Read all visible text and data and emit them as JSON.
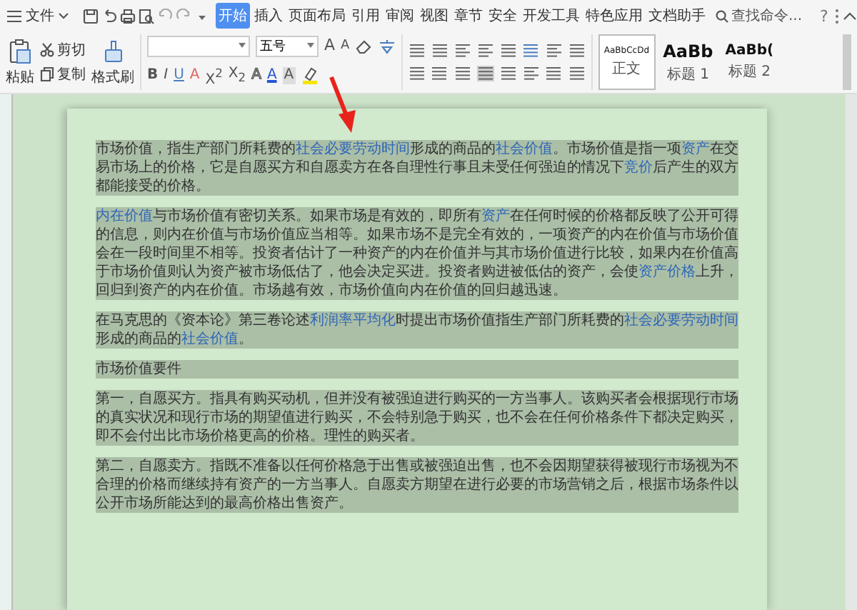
{
  "menu": {
    "label": "文件"
  },
  "tabs": [
    {
      "label": "开始",
      "selected": true
    },
    {
      "label": "插入",
      "selected": false
    },
    {
      "label": "页面布局",
      "selected": false
    },
    {
      "label": "引用",
      "selected": false
    },
    {
      "label": "审阅",
      "selected": false
    },
    {
      "label": "视图",
      "selected": false
    },
    {
      "label": "章节",
      "selected": false
    },
    {
      "label": "安全",
      "selected": false
    },
    {
      "label": "开发工具",
      "selected": false
    },
    {
      "label": "特色应用",
      "selected": false
    },
    {
      "label": "文档助手",
      "selected": false
    }
  ],
  "search": {
    "placeholder": "查找命令..."
  },
  "help": {
    "label": "?"
  },
  "clipboard": {
    "paste": "粘贴",
    "cut": "剪切",
    "copy": "复制",
    "format_painter": "格式刷"
  },
  "font": {
    "size": "五号"
  },
  "font_buttons": [
    {
      "label": "A",
      "kind": "grow"
    },
    {
      "label": "A",
      "kind": "shrink"
    }
  ],
  "format_buttons": [
    {
      "label": "B",
      "kind": "bold"
    },
    {
      "label": "I",
      "kind": "italic"
    },
    {
      "label": "U",
      "kind": "underline"
    },
    {
      "label": "A",
      "kind": "effect"
    },
    {
      "label": "X$^{2}$",
      "kind": "plain"
    },
    {
      "label": "X$_{2}$",
      "kind": "plain"
    },
    {
      "label": "A",
      "kind": "outline"
    },
    {
      "label": "A",
      "kind": "color"
    },
    {
      "label": "A",
      "kind": "shade"
    }
  ],
  "styles": [
    {
      "preview": "AaBbCcDd",
      "label": "正文",
      "kind": "normal",
      "selected": true
    },
    {
      "preview": "AaBb",
      "label": "标题 1",
      "kind": "heading1",
      "selected": false
    },
    {
      "preview": "AaBb(",
      "label": "标题 2",
      "kind": "heading2",
      "selected": false
    }
  ],
  "document": {
    "paragraphs": [
      {
        "selected": true,
        "runs": [
          {
            "text": "市场价值，指生产部门所耗费的",
            "link": false
          },
          {
            "text": "社会必要劳动时间",
            "link": true
          },
          {
            "text": "形成的商品的",
            "link": false
          },
          {
            "text": "社会价值",
            "link": true
          },
          {
            "text": "。市场价值是指一项",
            "link": false
          },
          {
            "text": "资产",
            "link": true
          },
          {
            "text": "在交易市场上的价格，它是自愿买方和自愿卖方在各自理性行事且未受任何强迫的情况下",
            "link": false
          },
          {
            "text": "竞价",
            "link": true
          },
          {
            "text": "后产生的双方都能接受的价格。",
            "link": false
          }
        ]
      },
      {
        "selected": true,
        "runs": [
          {
            "text": "内在价值",
            "link": true
          },
          {
            "text": "与市场价值有密切关系。如果市场是有效的，即所有",
            "link": false
          },
          {
            "text": "资产",
            "link": true
          },
          {
            "text": "在任何时候的价格都反映了公开可得的信息，则内在价值与市场价值应当相等。如果市场不是完全有效的，一项资产的内在价值与市场价值会在一段时间里不相等。投资者估计了一种资产的内在价值并与其市场价值进行比较，如果内在价值高于市场价值则认为资产被市场低估了，他会决定买进。投资者购进被低估的资产，会使",
            "link": false
          },
          {
            "text": "资产价格",
            "link": true
          },
          {
            "text": "上升，回归到资产的内在价值。市场越有效，市场价值向内在价值的回归越迅速。",
            "link": false
          }
        ]
      },
      {
        "selected": true,
        "runs": [
          {
            "text": "在马克思的《资本论》第三卷论述",
            "link": false
          },
          {
            "text": "利润率平均化",
            "link": true
          },
          {
            "text": "时提出市场价值指生产部门所耗费的",
            "link": false
          },
          {
            "text": "社会必要劳动时间",
            "link": true
          },
          {
            "text": "形成的商品的",
            "link": false
          },
          {
            "text": "社会价值",
            "link": true
          },
          {
            "text": "。",
            "link": false
          }
        ]
      },
      {
        "selected": true,
        "runs": [
          {
            "text": "市场价值要件",
            "link": false
          }
        ]
      },
      {
        "selected": true,
        "runs": [
          {
            "text": "第一，自愿买方。指具有购买动机，但并没有被强迫进行购买的一方当事人。该购买者会根据现行市场的真实状况和现行市场的期望值进行购买，不会特别急于购买，也不会在任何价格条件下都决定购买，即不会付出比市场价格更高的价格。理性的购买者。",
            "link": false
          }
        ]
      },
      {
        "selected": true,
        "runs": [
          {
            "text": "第二，自愿卖方。指既不准备以任何价格急于出售或被强迫出售，也不会因期望获得被现行市场视为不合理的价格而继续持有资产的一方当事人。自愿卖方期望在进行必要的市场营销之后，根据市场条件以公开市场所能达到的最高价格出售资产。",
            "link": false
          }
        ]
      }
    ]
  }
}
